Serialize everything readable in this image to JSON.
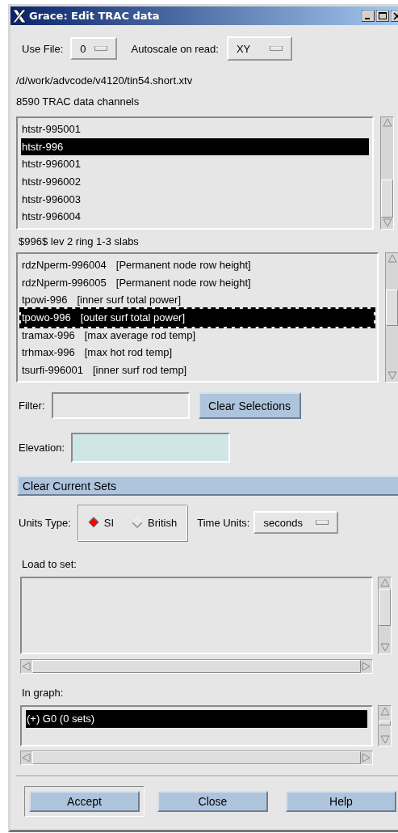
{
  "window": {
    "title": "Grace: Edit TRAC data"
  },
  "use_file": {
    "label": "Use File:",
    "value": "0"
  },
  "autoscale": {
    "label": "Autoscale on read:",
    "value": "XY"
  },
  "file_path": "/d/work/advcode/v4120/tin54.short.xtv",
  "channel_count": "8590 TRAC data channels",
  "channel_list": {
    "items": [
      {
        "label": "htstr-995001",
        "selected": false
      },
      {
        "label": "htstr-996",
        "selected": true
      },
      {
        "label": "htstr-996001",
        "selected": false
      },
      {
        "label": "htstr-996002",
        "selected": false
      },
      {
        "label": "htstr-996003",
        "selected": false
      },
      {
        "label": "htstr-996004",
        "selected": false
      }
    ]
  },
  "group_description": "$996$ lev 2 ring 1-3 slabs",
  "variable_list": {
    "items": [
      {
        "name": "rdzNperm-996004",
        "description": "[Permanent node row height]",
        "selected": false,
        "focused": false
      },
      {
        "name": "rdzNperm-996005",
        "description": "[Permanent node row height]",
        "selected": false,
        "focused": false
      },
      {
        "name": "tpowi-996",
        "description": "[inner surf total power]",
        "selected": false,
        "focused": false
      },
      {
        "name": "tpowo-996",
        "description": "[outer surf total power]",
        "selected": true,
        "focused": true
      },
      {
        "name": "tramax-996",
        "description": "[max average rod temp]",
        "selected": false,
        "focused": false
      },
      {
        "name": "trhmax-996",
        "description": "[max hot rod temp]",
        "selected": false,
        "focused": false
      },
      {
        "name": "tsurfi-996001",
        "description": "[inner surf rod temp]",
        "selected": false,
        "focused": false
      }
    ]
  },
  "filter": {
    "label": "Filter:"
  },
  "clear_selections": "Clear Selections",
  "elevation": {
    "label": "Elevation:"
  },
  "clear_current_sets": "Clear Current Sets",
  "units_type": {
    "label": "Units Type:",
    "options": [
      {
        "label": "SI",
        "selected": true
      },
      {
        "label": "British",
        "selected": false
      }
    ]
  },
  "time_units": {
    "label": "Time Units:",
    "value": "seconds"
  },
  "load_to_set": {
    "label": "Load to set:"
  },
  "in_graph": {
    "label": "In graph:",
    "items": [
      {
        "label": "(+) G0 (0 sets)",
        "selected": true
      }
    ]
  },
  "buttons": [
    {
      "label": "Accept",
      "focused": true
    },
    {
      "label": "Close",
      "focused": false
    },
    {
      "label": "Help",
      "focused": false
    }
  ]
}
